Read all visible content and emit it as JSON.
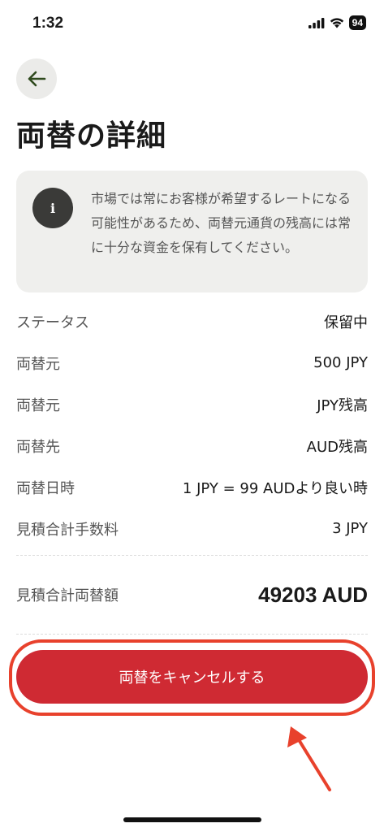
{
  "status_bar": {
    "time": "1:32",
    "battery": "94",
    "icons": [
      "signal-icon",
      "wifi-icon",
      "battery-icon"
    ]
  },
  "header": {
    "back_icon": "arrow-left-icon",
    "title": "両替の詳細"
  },
  "info": {
    "icon": "info-icon",
    "icon_glyph": "i",
    "text": "市場では常にお客様が希望するレートになる可能性があるため、両替元通貨の残高には常に十分な資金を保有してください。"
  },
  "details": [
    {
      "label": "ステータス",
      "value": "保留中"
    },
    {
      "label": "両替元",
      "value": "500 JPY"
    },
    {
      "label": "両替元",
      "value": "JPY残高"
    },
    {
      "label": "両替先",
      "value": "AUD残高"
    },
    {
      "label": "両替日時",
      "value": "1 JPY = 99 AUDより良い時"
    },
    {
      "label": "見積合計手数料",
      "value": "3 JPY"
    }
  ],
  "total": {
    "label": "見積合計両替額",
    "value": "49203 AUD"
  },
  "actions": {
    "cancel_label": "両替をキャンセルする"
  },
  "colors": {
    "accent_red": "#cf2a33",
    "highlight": "#e8412c",
    "back_arrow": "#2f4a1e",
    "info_bg": "#efefed"
  }
}
